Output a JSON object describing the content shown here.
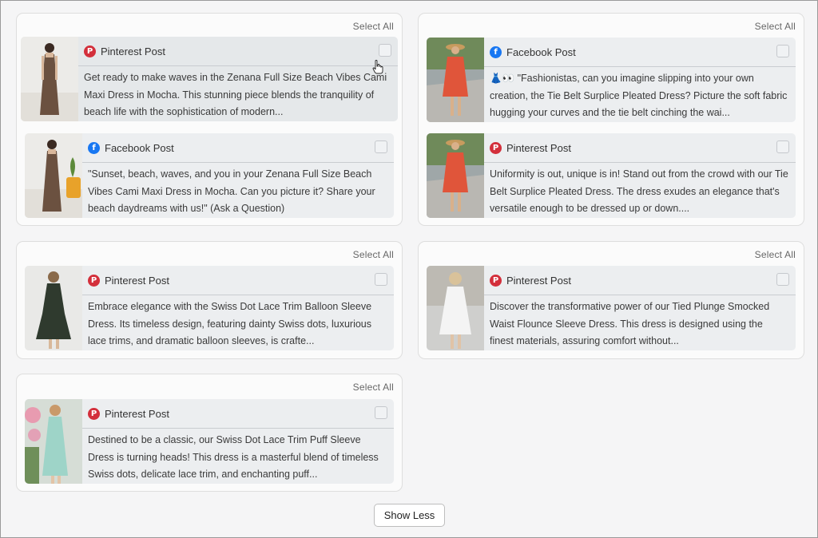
{
  "select_all_label": "Select All",
  "show_less_label": "Show Less",
  "colors": {
    "pinterest": "#d32f3b",
    "facebook": "#1877f2"
  },
  "groups": [
    {
      "cards": [
        {
          "network": "Pinterest Post",
          "icon": "pinterest-icon",
          "text": "Get ready to make waves in the Zenana Full Size Beach Vibes Cami Maxi Dress in Mocha. This stunning piece blends the tranquility of beach life with the sophistication of modern..."
        },
        {
          "network": "Facebook Post",
          "icon": "facebook-icon",
          "text": "\"Sunset, beach, waves, and you in your Zenana Full Size Beach Vibes Cami Maxi Dress in Mocha. Can you picture it? Share your beach daydreams with us!\" (Ask a Question)"
        }
      ]
    },
    {
      "cards": [
        {
          "network": "Facebook Post",
          "icon": "facebook-icon",
          "text": "👗👀 \"Fashionistas, can you imagine slipping into your own creation, the Tie Belt Surplice Pleated Dress? Picture the soft fabric hugging your curves and the tie belt cinching the wai..."
        },
        {
          "network": "Pinterest Post",
          "icon": "pinterest-icon",
          "text": "Uniformity is out, unique is in! Stand out from the crowd with our Tie Belt Surplice Pleated Dress. The dress exudes an elegance that's versatile enough to be dressed up or down...."
        }
      ]
    },
    {
      "cards": [
        {
          "network": "Pinterest Post",
          "icon": "pinterest-icon",
          "text": "Embrace elegance with the Swiss Dot Lace Trim Balloon Sleeve Dress. Its timeless design, featuring dainty Swiss dots, luxurious lace trims, and dramatic balloon sleeves, is crafte..."
        }
      ]
    },
    {
      "cards": [
        {
          "network": "Pinterest Post",
          "icon": "pinterest-icon",
          "text": "Discover the transformative power of our Tied Plunge Smocked Waist Flounce Sleeve Dress. This dress is designed using the finest materials, assuring comfort without..."
        }
      ]
    },
    {
      "cards": [
        {
          "network": "Pinterest Post",
          "icon": "pinterest-icon",
          "text": "Destined to be a classic, our Swiss Dot Lace Trim Puff Sleeve Dress is turning heads! This dress is a masterful blend of timeless Swiss dots, delicate lace trim, and enchanting puff..."
        }
      ]
    }
  ]
}
